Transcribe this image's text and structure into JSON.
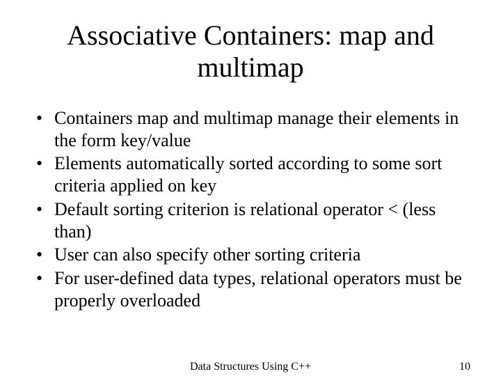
{
  "title": "Associative Containers: map and multimap",
  "bullets": [
    "Containers map and multimap manage their elements in the form key/value",
    "Elements automatically sorted according to some sort criteria applied on key",
    "Default sorting criterion is relational operator < (less than)",
    "User can also specify other sorting criteria",
    "For user-defined data types, relational operators must be properly overloaded"
  ],
  "footer": {
    "text": "Data Structures Using C++",
    "page": "10"
  }
}
